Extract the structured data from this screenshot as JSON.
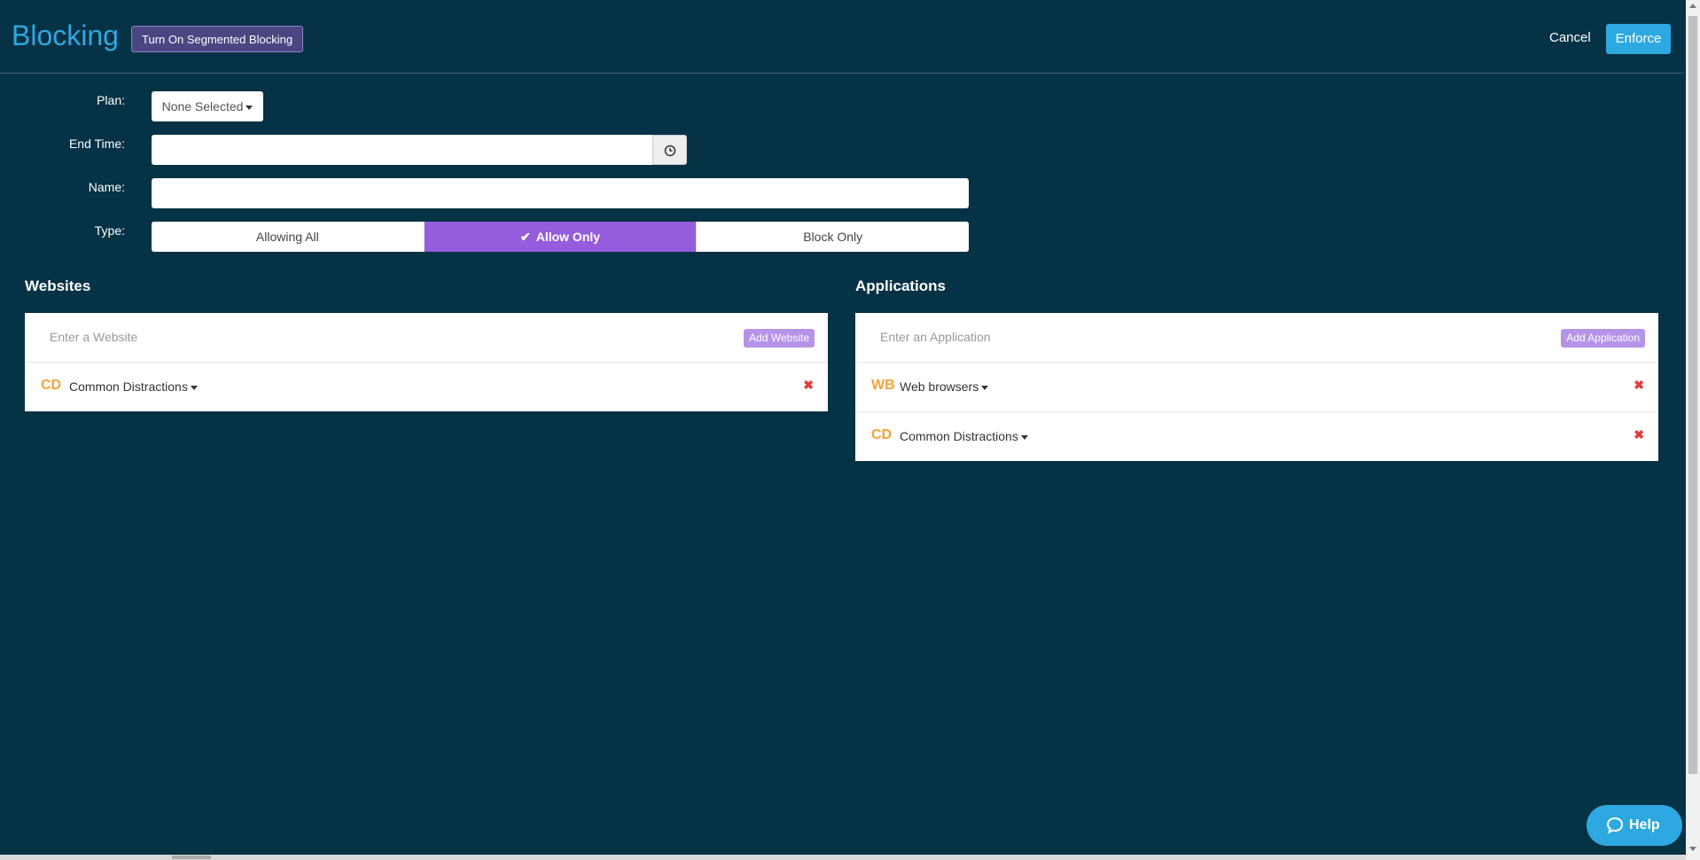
{
  "header": {
    "title": "Blocking",
    "segmented_button": "Turn On Segmented Blocking",
    "cancel": "Cancel",
    "enforce": "Enforce"
  },
  "form": {
    "plan_label": "Plan:",
    "plan_value": "None Selected",
    "end_time_label": "End Time:",
    "end_time_value": "",
    "name_label": "Name:",
    "name_value": "",
    "type_label": "Type:",
    "type_options": [
      "Allowing All",
      "Allow Only",
      "Block Only"
    ],
    "type_selected": "Allow Only"
  },
  "websites": {
    "title": "Websites",
    "input_placeholder": "Enter a Website",
    "add_button": "Add Website",
    "items": [
      {
        "badge": "CD",
        "label": "Common Distractions"
      }
    ]
  },
  "applications": {
    "title": "Applications",
    "input_placeholder": "Enter an Application",
    "add_button": "Add Application",
    "items": [
      {
        "badge": "WB",
        "label": "Web browsers"
      },
      {
        "badge": "CD",
        "label": "Common Distractions"
      }
    ]
  },
  "help": {
    "label": "Help"
  },
  "colors": {
    "background": "#063246",
    "accent": "#2ea8e0",
    "selected_type": "#955ddd",
    "badge": "#f2a33a",
    "remove": "#e23b3b"
  }
}
